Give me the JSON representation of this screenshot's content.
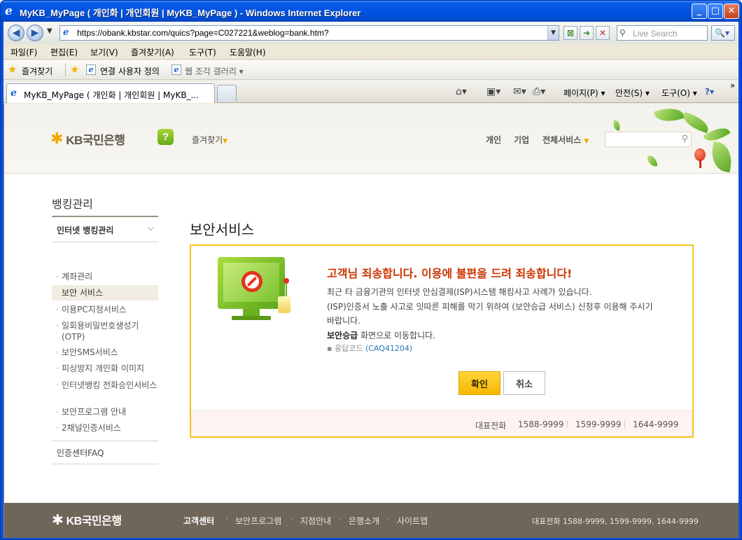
{
  "window": {
    "title": "MyKB_MyPage ( 개인화 | 개인회원 | MyKB_MyPage ) - Windows Internet Explorer",
    "min": "_",
    "max": "□",
    "close": "✕"
  },
  "addressbar": {
    "back": "◀",
    "forward": "▶",
    "url": "https://obank.kbstar.com/quics?page=C027221&weblog=bank.htm?",
    "refresh": "➜",
    "stop": "✕",
    "compat": "⊠",
    "search_placeholder": "Live Search",
    "search_button": "🔍▾"
  },
  "menubar": {
    "items": [
      "파일(F)",
      "편집(E)",
      "보기(V)",
      "즐겨찾기(A)",
      "도구(T)",
      "도움말(H)"
    ]
  },
  "favbar": {
    "favorites": "즐겨찾기",
    "suggested_sites": "연결 사용자 정의",
    "web_slice": "웹 조각 갤러리 ▾"
  },
  "tabbar": {
    "tab_label": "MyKB_MyPage ( 개인화 | 개인회원 | MyKB_...",
    "page_menu": "페이지(P) ▾",
    "safety_menu": "안전(S) ▾",
    "tools_menu": "도구(O) ▾",
    "help_menu": "?▾",
    "more": "»"
  },
  "header": {
    "logo_mark": "✱",
    "logo_text": "KB국민은행",
    "help_icon": "?",
    "favorites_label": "즐겨찾기",
    "gnb": [
      "개인",
      "기업",
      "전체서비스"
    ]
  },
  "lnb": {
    "title": "뱅킹관리",
    "section": "인터넷 뱅킹관리",
    "items": [
      "계좌관리",
      "보안 서비스",
      "이용PC지정서비스",
      "일회용비밀번호생성기(OTP)",
      "보안SMS서비스",
      "피싱방지 개인화 이미지",
      "인터넷뱅킹 전화승인서비스",
      "보안프로그램 안내",
      "2채널인증서비스"
    ],
    "faq": "인증센터FAQ"
  },
  "main": {
    "page_title": "보안서비스",
    "message": {
      "title": "고객님 죄송합니다. 이용에 불편을 드려 죄송합니다!",
      "line1": "최근 타 금융기관의 인터넷 안심결제(ISP)시스템 해킹사고 사례가 있습니다.",
      "line2": "(ISP)인증서 노출 사고로 잇따른 피해를 막기 위하여 (보안승급 서비스) 신청후 이용해 주시기",
      "line3": "바랍니다.",
      "line4_bold": "보안승급",
      "line4_rest": " 화면으로 이동합니다.",
      "resp_label": "응답코드",
      "resp_code": "(CAQ41204)"
    },
    "ok_button": "확인",
    "cancel_button": "취소",
    "phone_label": "대표전화",
    "phones": [
      "1588-9999",
      "1599-9999",
      "1644-9999"
    ]
  },
  "footer": {
    "logo_text": "KB국민은행",
    "links": [
      "고객센터",
      "보안프로그램",
      "지점안내",
      "은행소개",
      "사이트맵"
    ],
    "phone": "대표전화 1588-9999, 1599-9999, 1644-9999"
  },
  "colors": {
    "accent": "#f5c21b",
    "alert_title": "#cc3300",
    "footer_bg": "#6f6659"
  }
}
